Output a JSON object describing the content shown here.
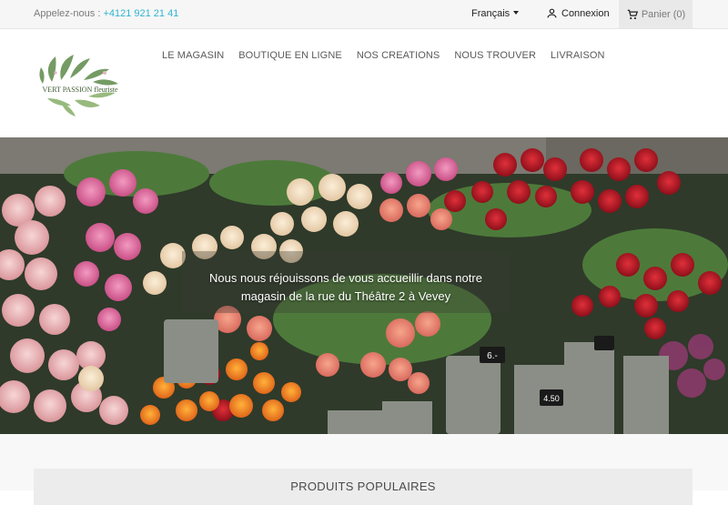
{
  "topbar": {
    "phone_label": "Appelez-nous : ",
    "phone_number": "+4121 921 21 41",
    "language": "Français",
    "login": "Connexion",
    "cart": "Panier (0)"
  },
  "logo": {
    "text": "VERT PASSION fleuriste"
  },
  "nav": {
    "items": [
      "LE MAGASIN",
      "BOUTIQUE EN LIGNE",
      "NOS CREATIONS",
      "NOUS TROUVER",
      "LIVRAISON"
    ]
  },
  "hero": {
    "caption_line1": "Nous nous réjouissons de vous accueillir dans notre",
    "caption_line2": "magasin de la rue du Théâtre 2 à Vevey",
    "price_tags": [
      "6.-",
      "4.50"
    ]
  },
  "products": {
    "title": "PRODUITS POPULAIRES"
  },
  "colors": {
    "accent": "#2fb5d2",
    "topbar_bg": "#f6f6f6",
    "cart_bg": "#e9e9e9"
  }
}
